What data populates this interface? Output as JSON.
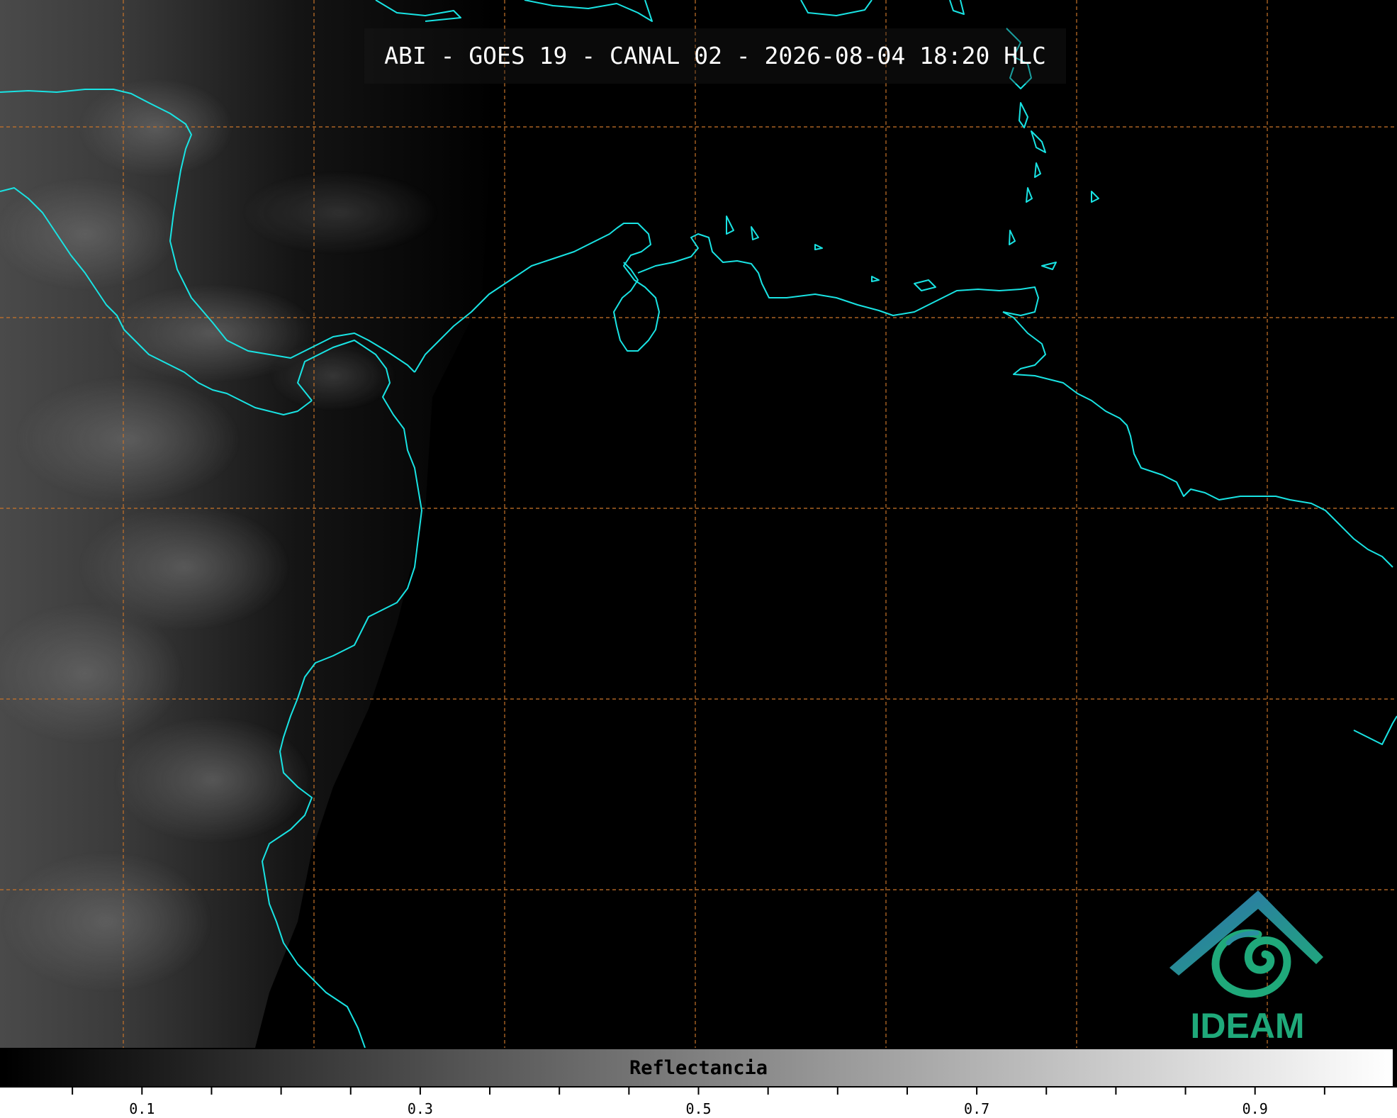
{
  "title": "ABI - GOES 19 - CANAL 02 - 2026-08-04 18:20 HLC",
  "colorbar": {
    "label": "Reflectancia",
    "tick_labels": [
      "0.1",
      "0.3",
      "0.5",
      "0.7",
      "0.9"
    ],
    "range": [
      0.0,
      1.0
    ],
    "colormap": "grayscale black-to-white"
  },
  "logo": {
    "text": "IDEAM"
  },
  "colors": {
    "coastline": "#19e3e3",
    "graticule": "#c8742a",
    "background": "#000000",
    "logo_green": "#1fa97a",
    "logo_blue": "#2f6fb0"
  }
}
